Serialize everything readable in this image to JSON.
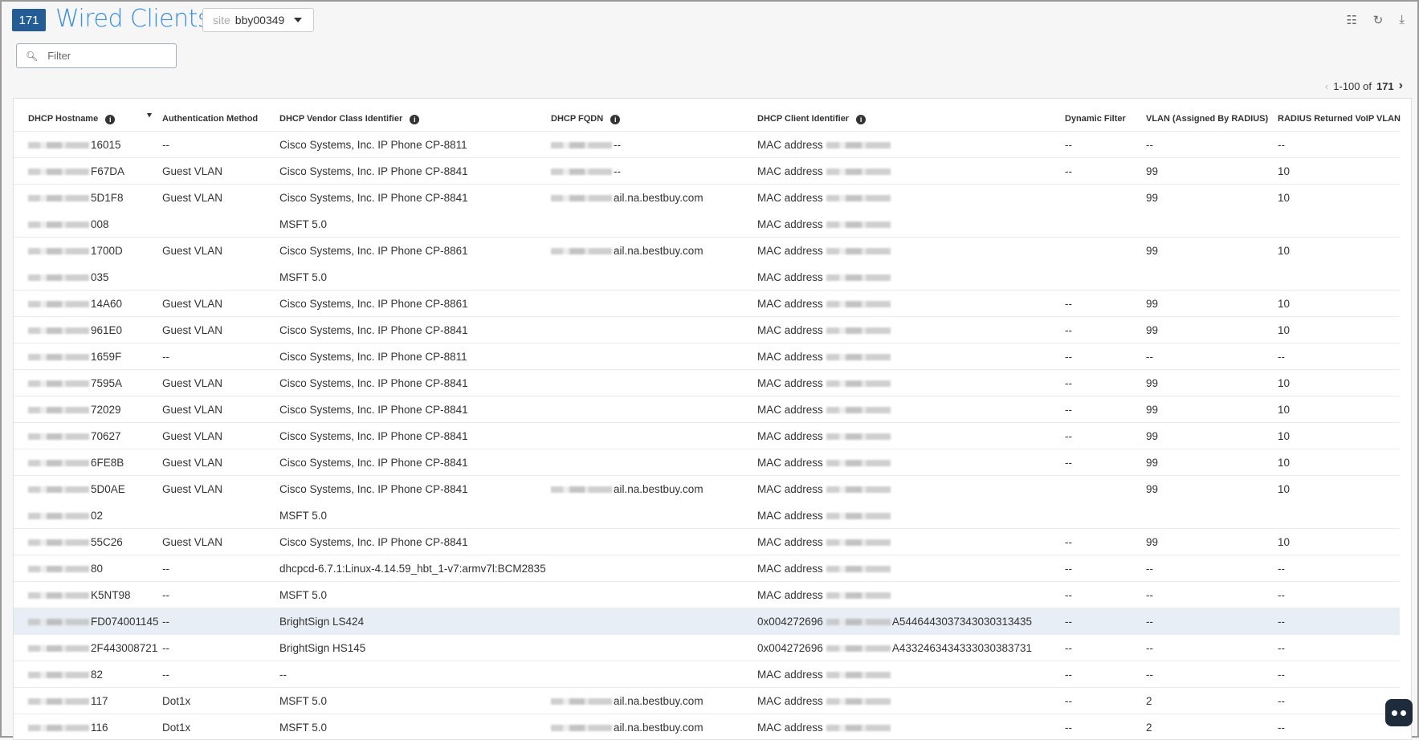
{
  "header": {
    "count": "171",
    "title": "Wired Clients",
    "site_label": "site",
    "site_value": "bby00349"
  },
  "filter": {
    "placeholder": "Filter"
  },
  "pager": {
    "range": "1-100 of",
    "total": "171"
  },
  "columns": [
    "DHCP Hostname",
    "Authentication Method",
    "DHCP Vendor Class Identifier",
    "DHCP FQDN",
    "DHCP Client Identifier",
    "Dynamic Filter",
    "VLAN (Assigned By RADIUS)",
    "RADIUS Returned VoIP VLAN"
  ],
  "rows": [
    {
      "h": "16015",
      "a": "--",
      "v": "Cisco Systems, Inc. IP Phone CP-8811",
      "f": "--",
      "ci": "MAC address",
      "df": "--",
      "vl": "--",
      "vo": "--"
    },
    {
      "h": "F67DA",
      "a": "Guest VLAN",
      "v": "Cisco Systems, Inc. IP Phone CP-8841",
      "f": "--",
      "ci": "MAC address",
      "df": "--",
      "vl": "99",
      "vo": "10"
    },
    {
      "h": "5D1F8",
      "a": "Guest VLAN",
      "v": "Cisco Systems, Inc. IP Phone CP-8841",
      "f": "ail.na.bestbuy.com",
      "ci": "MAC address",
      "df": "",
      "vl": "99",
      "vo": "10"
    },
    {
      "h": "008",
      "a": "",
      "v": "MSFT 5.0",
      "f": "",
      "ci": "MAC address",
      "df": "",
      "vl": "",
      "vo": "",
      "cont": true
    },
    {
      "h": "1700D",
      "a": "Guest VLAN",
      "v": "Cisco Systems, Inc. IP Phone CP-8861",
      "f": "ail.na.bestbuy.com",
      "ci": "MAC address",
      "df": "",
      "vl": "99",
      "vo": "10"
    },
    {
      "h": "035",
      "a": "",
      "v": "MSFT 5.0",
      "f": "",
      "ci": "MAC address",
      "df": "",
      "vl": "",
      "vo": "",
      "cont": true
    },
    {
      "h": "14A60",
      "a": "Guest VLAN",
      "v": "Cisco Systems, Inc. IP Phone CP-8861",
      "f": "",
      "ci": "MAC address",
      "df": "--",
      "vl": "99",
      "vo": "10"
    },
    {
      "h": "961E0",
      "a": "Guest VLAN",
      "v": "Cisco Systems, Inc. IP Phone CP-8841",
      "f": "",
      "ci": "MAC address",
      "df": "--",
      "vl": "99",
      "vo": "10"
    },
    {
      "h": "1659F",
      "a": "--",
      "v": "Cisco Systems, Inc. IP Phone CP-8811",
      "f": "",
      "ci": "MAC address",
      "df": "--",
      "vl": "--",
      "vo": "--"
    },
    {
      "h": "7595A",
      "a": "Guest VLAN",
      "v": "Cisco Systems, Inc. IP Phone CP-8841",
      "f": "",
      "ci": "MAC address",
      "df": "--",
      "vl": "99",
      "vo": "10"
    },
    {
      "h": "72029",
      "a": "Guest VLAN",
      "v": "Cisco Systems, Inc. IP Phone CP-8841",
      "f": "",
      "ci": "MAC address",
      "df": "--",
      "vl": "99",
      "vo": "10"
    },
    {
      "h": "70627",
      "a": "Guest VLAN",
      "v": "Cisco Systems, Inc. IP Phone CP-8841",
      "f": "",
      "ci": "MAC address",
      "df": "--",
      "vl": "99",
      "vo": "10"
    },
    {
      "h": "6FE8B",
      "a": "Guest VLAN",
      "v": "Cisco Systems, Inc. IP Phone CP-8841",
      "f": "",
      "ci": "MAC address",
      "df": "--",
      "vl": "99",
      "vo": "10"
    },
    {
      "h": "5D0AE",
      "a": "Guest VLAN",
      "v": "Cisco Systems, Inc. IP Phone CP-8841",
      "f": "ail.na.bestbuy.com",
      "ci": "MAC address",
      "df": "",
      "vl": "99",
      "vo": "10"
    },
    {
      "h": "02",
      "a": "",
      "v": "MSFT 5.0",
      "f": "",
      "ci": "MAC address",
      "df": "",
      "vl": "",
      "vo": "",
      "cont": true
    },
    {
      "h": "55C26",
      "a": "Guest VLAN",
      "v": "Cisco Systems, Inc. IP Phone CP-8841",
      "f": "",
      "ci": "MAC address",
      "df": "--",
      "vl": "99",
      "vo": "10"
    },
    {
      "h": "80",
      "a": "--",
      "v": "dhcpcd-6.7.1:Linux-4.14.59_hbt_1-v7:armv7l:BCM2835",
      "f": "",
      "ci": "MAC address",
      "df": "--",
      "vl": "--",
      "vo": "--"
    },
    {
      "h": "K5NT98",
      "a": "--",
      "v": "MSFT 5.0",
      "f": "",
      "ci": "MAC address",
      "df": "--",
      "vl": "--",
      "vo": "--"
    },
    {
      "h": "FD074001145",
      "a": "--",
      "v": "BrightSign LS424",
      "f": "",
      "ci": "0x004272696",
      "ci2": "A5446443037343030313435",
      "df": "--",
      "vl": "--",
      "vo": "--",
      "sel": true
    },
    {
      "h": "2F443008721",
      "a": "--",
      "v": "BrightSign HS145",
      "f": "",
      "ci": "0x004272696",
      "ci2": "A4332463434333030383731",
      "df": "--",
      "vl": "--",
      "vo": "--"
    },
    {
      "h": "82",
      "a": "--",
      "v": "--",
      "f": "",
      "ci": "MAC address",
      "df": "--",
      "vl": "--",
      "vo": "--"
    },
    {
      "h": "117",
      "a": "Dot1x",
      "v": "MSFT 5.0",
      "f": "ail.na.bestbuy.com",
      "ci": "MAC address",
      "df": "--",
      "vl": "2",
      "vo": "--"
    },
    {
      "h": "116",
      "a": "Dot1x",
      "v": "MSFT 5.0",
      "f": "ail.na.bestbuy.com",
      "ci": "MAC address",
      "df": "--",
      "vl": "2",
      "vo": "--"
    }
  ],
  "icons": {
    "columns": "sliders-icon",
    "refresh": "refresh-icon",
    "download": "download-icon"
  }
}
